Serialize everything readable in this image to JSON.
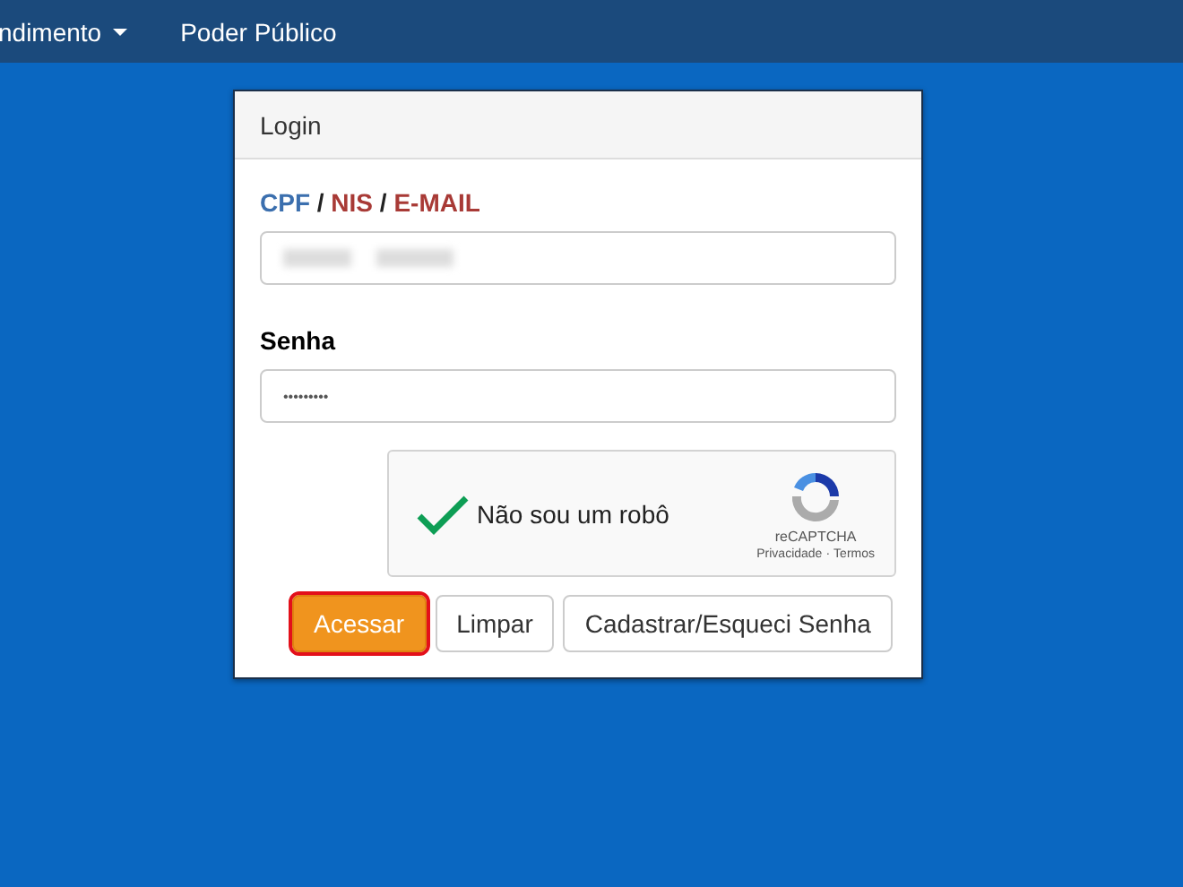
{
  "navbar": {
    "items": [
      {
        "label": "ndimento",
        "dropdown": true
      },
      {
        "label": "Poder Público",
        "dropdown": false
      }
    ]
  },
  "login": {
    "title": "Login",
    "user_label": [
      {
        "text": "CPF",
        "color": "#3b6fae"
      },
      {
        "text": " / ",
        "color": "#222222"
      },
      {
        "text": "NIS",
        "color": "#a83a36"
      },
      {
        "text": " / ",
        "color": "#222222"
      },
      {
        "text": "E-MAIL",
        "color": "#a83a36"
      }
    ],
    "password_label": "Senha",
    "password_value": "•••••••••",
    "captcha": {
      "label": "Não sou um robô",
      "checked": true,
      "brand": "reCAPTCHA",
      "links": [
        "Privacidade",
        "Termos"
      ],
      "separator": "·"
    },
    "buttons": [
      {
        "label": "Acessar",
        "kind": "primary",
        "highlighted": true
      },
      {
        "label": "Limpar",
        "kind": "default",
        "highlighted": false
      },
      {
        "label": "Cadastrar/Esqueci Senha",
        "kind": "default",
        "highlighted": false
      }
    ]
  }
}
